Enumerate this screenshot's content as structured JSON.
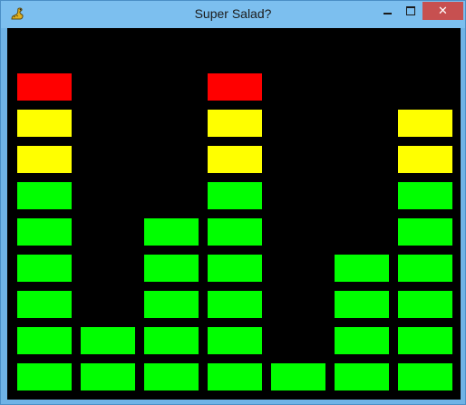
{
  "window": {
    "title": "Super Salad?",
    "icon": "python-snake-icon",
    "controls": {
      "minimize": "minimize-icon",
      "maximize": "maximize-icon",
      "close": "close-icon"
    },
    "close_glyph": "✕"
  },
  "game": {
    "background": "#000000",
    "colors": {
      "green": "#00ff00",
      "yellow": "#ffff00",
      "red": "#ff0000"
    },
    "columns": [
      {
        "blocks": [
          "green",
          "green",
          "green",
          "green",
          "green",
          "green",
          "yellow",
          "yellow",
          "red"
        ]
      },
      {
        "blocks": [
          "green",
          "green"
        ]
      },
      {
        "blocks": [
          "green",
          "green",
          "green",
          "green",
          "green"
        ]
      },
      {
        "blocks": [
          "green",
          "green",
          "green",
          "green",
          "green",
          "green",
          "yellow",
          "yellow",
          "red"
        ]
      },
      {
        "blocks": [
          "green"
        ]
      },
      {
        "blocks": [
          "green",
          "green",
          "green",
          "green"
        ]
      },
      {
        "blocks": [
          "green",
          "green",
          "green",
          "green",
          "green",
          "green",
          "yellow",
          "yellow"
        ]
      }
    ]
  }
}
